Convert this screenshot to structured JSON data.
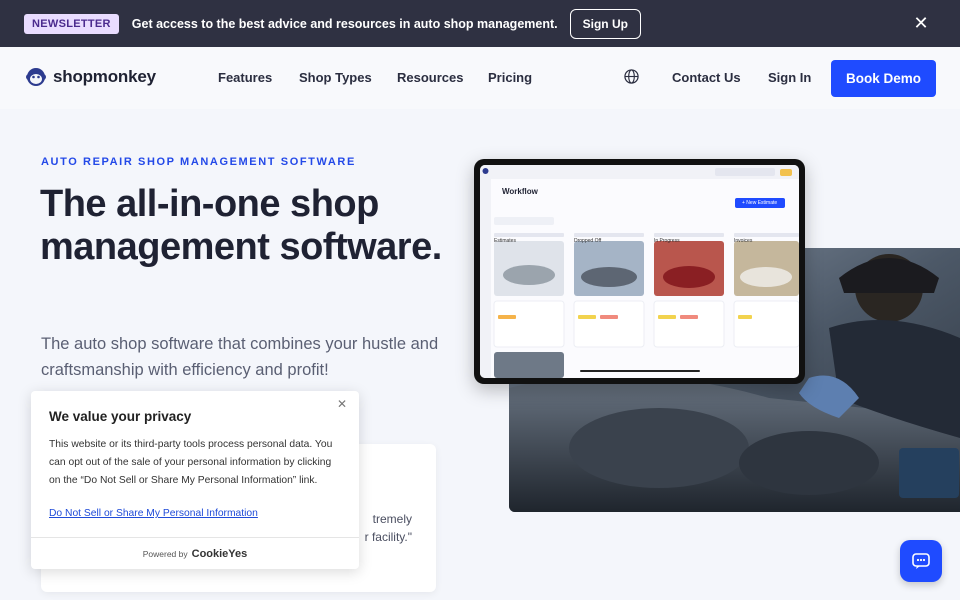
{
  "banner": {
    "badge": "NEWSLETTER",
    "text": "Get access to the best advice and resources in auto shop management.",
    "signup_label": "Sign Up",
    "close_icon": "close-icon"
  },
  "nav": {
    "logo_text": "shopmonkey",
    "links": [
      "Features",
      "Shop Types",
      "Resources",
      "Pricing"
    ],
    "globe_icon": "globe-icon",
    "contact": "Contact Us",
    "signin": "Sign In",
    "book_demo": "Book Demo"
  },
  "hero": {
    "eyebrow": "AUTO REPAIR SHOP MANAGEMENT SOFTWARE",
    "title": "The all-in-one shop management software.",
    "subtitle": "The auto shop software that combines your hustle and craftsmanship with efficiency and profit!"
  },
  "quote": {
    "text_line1": "tremely",
    "text_line2": "r facility.\""
  },
  "consent": {
    "title": "We value your privacy",
    "body": "This website or its third-party tools process personal data. You can opt out of the sale of your personal information by clicking on the “Do Not Sell or Share My Personal Information” link.",
    "link": "Do Not Sell or Share My Personal Information",
    "powered_by": "Powered by",
    "brand": "CookieYes"
  },
  "tablet": {
    "title": "Workflow",
    "new_estimate": "+ New Estimate",
    "columns": [
      "Estimates",
      "Dropped Off",
      "In Progress",
      "Invoices"
    ]
  },
  "colors": {
    "accent": "#1f4bff",
    "banner_bg": "#2f3142",
    "eyebrow": "#2349e8"
  },
  "chat_icon": "chat-icon"
}
